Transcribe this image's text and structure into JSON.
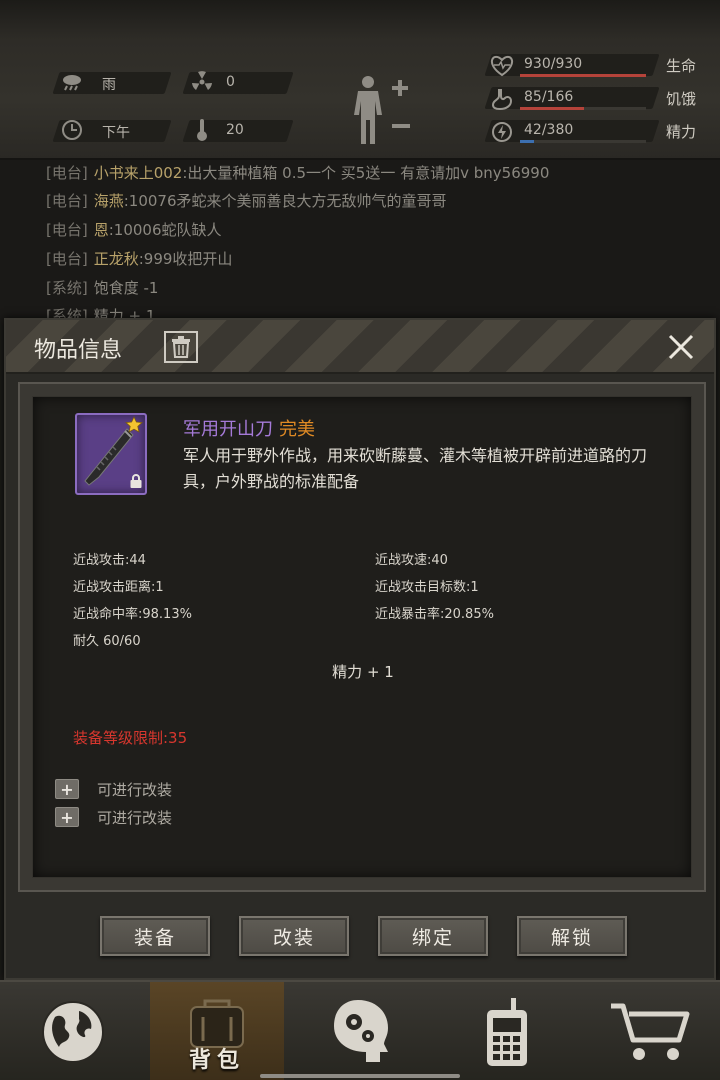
{
  "status": {
    "weather": "雨",
    "radiation": "0",
    "time_of_day": "下午",
    "temperature": "20"
  },
  "vitals": [
    {
      "label": "生命",
      "value": "930/930",
      "fraction": 1.0,
      "color": "#b5433a",
      "icon": "heart-pulse-icon"
    },
    {
      "label": "饥饿",
      "value": "85/166",
      "fraction": 0.51,
      "color": "#b5433a",
      "icon": "stomach-icon"
    },
    {
      "label": "精力",
      "value": "42/380",
      "fraction": 0.11,
      "color": "#3c6fb0",
      "icon": "energy-icon"
    }
  ],
  "chat": [
    {
      "channel": "[电台]",
      "name": "小书来上002",
      "text": ":出大量种植箱 0.5一个 买5送一 有意请加v bny56990"
    },
    {
      "channel": "[电台]",
      "name": "海燕",
      "text": ":10076矛蛇来个美丽善良大方无敌帅气的童哥哥"
    },
    {
      "channel": "[电台]",
      "name": "恩",
      "text": ":10006蛇队缺人"
    },
    {
      "channel": "[电台]",
      "name": "正龙秋",
      "text": ":999收把开山"
    },
    {
      "channel": "[系统]",
      "name": "",
      "text": "饱食度 -1"
    },
    {
      "channel": "[系统]",
      "name": "",
      "text": "精力 + 1"
    }
  ],
  "modal": {
    "title": "物品信息",
    "item": {
      "name": "军用开山刀",
      "quality": "完美",
      "description": "军人用于野外作战，用来砍断藤蔓、灌木等植被开辟前进道路的刀具，户外野战的标准配备"
    },
    "stats": {
      "melee_attack": "近战攻击:44",
      "melee_speed": "近战攻速:40",
      "melee_range": "近战攻击距离:1",
      "melee_targets": "近战攻击目标数:1",
      "melee_hit": "近战命中率:98.13%",
      "melee_crit": "近战暴击率:20.85%",
      "durability": "耐久 60/60"
    },
    "bonus": "精力 + 1",
    "level_limit": "装备等级限制:35",
    "mods": [
      "可进行改装",
      "可进行改装"
    ],
    "buttons": {
      "equip": "装备",
      "modify": "改装",
      "bind": "绑定",
      "unlock": "解锁"
    }
  },
  "nav": {
    "backpack_label": "背包"
  },
  "colors": {
    "quality_perfect": "#e08a24",
    "item_name": "#a57ad8",
    "limit_red": "#d8372e"
  }
}
